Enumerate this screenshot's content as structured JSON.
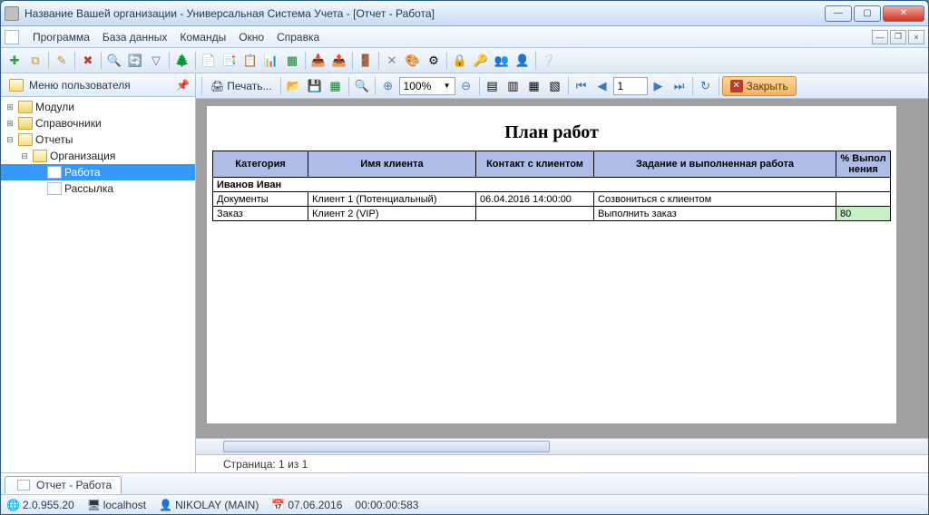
{
  "window": {
    "title": "Название Вашей организации - Универсальная Система Учета - [Отчет - Работа]"
  },
  "menu": {
    "program": "Программа",
    "database": "База данных",
    "commands": "Команды",
    "window": "Окно",
    "help": "Справка"
  },
  "sidebar": {
    "header": "Меню пользователя",
    "nodes": {
      "modules": "Модули",
      "directories": "Справочники",
      "reports": "Отчеты",
      "organization": "Организация",
      "work": "Работа",
      "mailing": "Рассылка"
    }
  },
  "reportbar": {
    "print": "Печать...",
    "zoom": "100%",
    "page": "1",
    "close": "Закрыть"
  },
  "report": {
    "title": "План работ",
    "headers": {
      "category": "Категория",
      "client": "Имя клиента",
      "contact": "Контакт с клиентом",
      "task": "Задание и выполненная работа",
      "pct": "% Выпол нения"
    },
    "group": "Иванов Иван",
    "rows": [
      {
        "category": "Документы",
        "client": "Клиент 1 (Потенциальный)",
        "contact": "06.04.2016 14:00:00",
        "task": "Созвониться с клиентом",
        "pct": ""
      },
      {
        "category": "Заказ",
        "client": "Клиент 2 (VIP)",
        "contact": "",
        "task": "Выполнить заказ",
        "pct": "80"
      }
    ],
    "pageinfo": "Страница: 1 из 1"
  },
  "tab": {
    "label": "Отчет - Работа"
  },
  "status": {
    "version": "2.0.955.20",
    "host": "localhost",
    "user": "NIKOLAY (MAIN)",
    "date": "07.06.2016",
    "elapsed": "00:00:00:583"
  }
}
